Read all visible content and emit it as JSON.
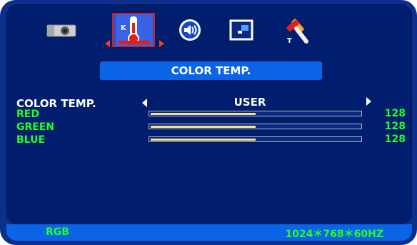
{
  "menu": {
    "title": "COLOR TEMP.",
    "icons": [
      "camera-icon",
      "thermometer-icon",
      "speaker-icon",
      "position-icon",
      "tool-icon"
    ],
    "selected_icon": "thermometer-icon"
  },
  "color_temp": {
    "label": "COLOR TEMP.",
    "value": "USER"
  },
  "channels": [
    {
      "label": "RED",
      "value": "128",
      "level": 0.5
    },
    {
      "label": "GREEN",
      "value": "128",
      "level": 0.5
    },
    {
      "label": "BLUE",
      "value": "128",
      "level": 0.5
    }
  ],
  "status": {
    "input": "RGB",
    "resolution": "1024＊768＊60HZ"
  },
  "colors": {
    "osd_bg": "#001d6e",
    "accent_blue": "#0b63e5",
    "label_green": "#22ff22",
    "bar_fill": "#f2e48a",
    "selection_red": "#d3201b"
  }
}
